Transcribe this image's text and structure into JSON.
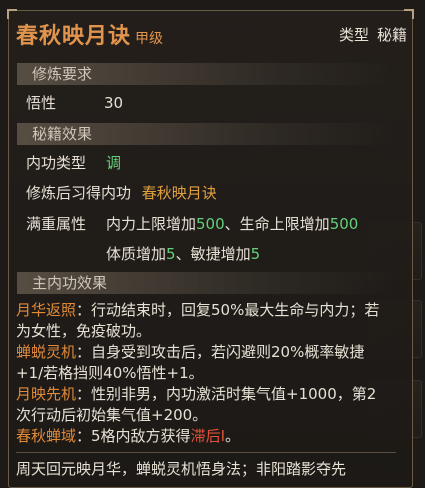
{
  "title": "春秋映月诀",
  "grade": "甲级",
  "type_label": "类型",
  "type_value": "秘籍",
  "sections": {
    "requirements": "修炼要求",
    "effects": "秘籍效果",
    "main_effects": "主内功效果"
  },
  "requirements": {
    "label": "悟性",
    "value": "30"
  },
  "stats": {
    "internal_type_label": "内功类型",
    "internal_type_value": "调",
    "learned_label": "修炼后习得内功",
    "learned_value": "春秋映月诀",
    "full_label": "满重属性",
    "line1_a": "内力上限增加",
    "line1_a_val": "500",
    "line1_sep": "、",
    "line1_b": "生命上限增加",
    "line1_b_val": "500",
    "line2_a": "体质增加",
    "line2_a_val": "5",
    "line2_sep": "、",
    "line2_b": "敏捷增加",
    "line2_b_val": "5"
  },
  "effects": [
    {
      "name": "月华返照",
      "text": "：行动结束时，回复50%最大生命与内力；若为女性，免疫破功。"
    },
    {
      "name": "蝉蜕灵机",
      "text": "：自身受到攻击后，若闪避则20%概率敏捷+1/若格挡则40%悟性+1。"
    },
    {
      "name": "月映先机",
      "text": "：性别非男，内功激活时集气值+1000，第2次行动后初始集气值+200。"
    },
    {
      "name": "春秋蝉域",
      "text": "：5格内敌方获得",
      "highlight": "滞后Ⅰ",
      "end": "。"
    }
  ],
  "footer": "周天回元映月华，蝉蜕灵机悟身法；非阳踏影夺先",
  "colors": {
    "title": "#e1944d",
    "effect_name": "#e08a3a",
    "value_green": "#63d07a",
    "debuff_red": "#e0523a"
  }
}
